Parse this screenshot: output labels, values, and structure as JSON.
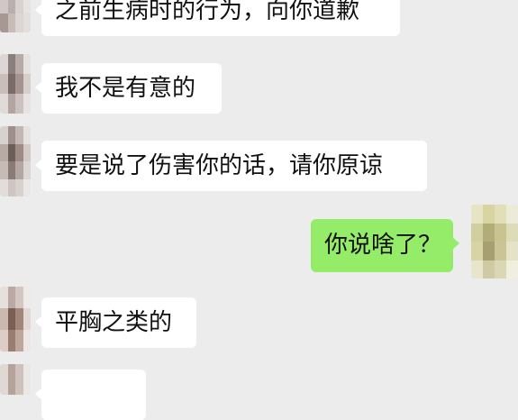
{
  "chat": {
    "messages": [
      {
        "side": "in",
        "text": "之前生病时的行为，向你道歉"
      },
      {
        "side": "in",
        "text": "我不是有意的"
      },
      {
        "side": "in",
        "text": "要是说了伤害你的话，请你原谅"
      },
      {
        "side": "out",
        "text": "你说啥了？"
      },
      {
        "side": "in",
        "text": "平胸之类的"
      },
      {
        "side": "in",
        "text": ""
      }
    ]
  },
  "colors": {
    "background": "#ececec",
    "incoming_bubble": "#ffffff",
    "outgoing_bubble": "#95ec69"
  }
}
